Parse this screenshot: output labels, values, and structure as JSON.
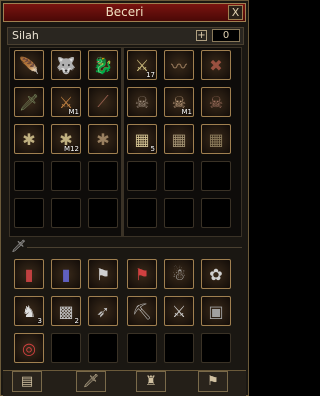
{
  "window": {
    "title": "Beceri",
    "close_label": "X"
  },
  "category": {
    "name": "Silah",
    "plus_label": "+",
    "count": "0"
  },
  "skills_grid": {
    "rows": [
      [
        {
          "icon": "wing-icon",
          "color": "#d8c090"
        },
        {
          "icon": "beast-icon",
          "color": "#c0a080"
        },
        {
          "icon": "dragon-icon",
          "color": "#b06050"
        },
        {
          "icon": "claw-icon",
          "color": "#d0c080",
          "lvl": "17"
        },
        {
          "icon": "sweep-icon",
          "color": "#a08060"
        },
        {
          "icon": "cross-slash-icon",
          "color": "#9a5040"
        }
      ],
      [
        {
          "icon": "sword-icon",
          "color": "#7a8a60"
        },
        {
          "icon": "blade-icon",
          "color": "#c08040",
          "lvl": "M1"
        },
        {
          "icon": "slash-icon",
          "color": "#9a6050"
        },
        {
          "icon": "skull-icon",
          "color": "#a09080"
        },
        {
          "icon": "skull-icon",
          "color": "#c0a080",
          "lvl": "M1"
        },
        {
          "icon": "skull-icon",
          "color": "#a07060"
        }
      ],
      [
        {
          "icon": "spider-icon",
          "color": "#c0b080"
        },
        {
          "icon": "spider-icon",
          "color": "#c0b080",
          "lvl": "M12"
        },
        {
          "icon": "spider-icon",
          "color": "#9a8060"
        },
        {
          "icon": "grid-icon",
          "color": "#d0c090",
          "lvl": "5"
        },
        {
          "icon": "grid-icon",
          "color": "#a09070"
        },
        {
          "icon": "grid-icon",
          "color": "#8a7a5a"
        }
      ]
    ]
  },
  "passive_grid": {
    "rows": [
      [
        {
          "icon": "book-icon",
          "color": "#c04040"
        },
        {
          "icon": "book-icon",
          "color": "#6060c0"
        },
        {
          "icon": "flag-icon",
          "color": "#d0d0d0"
        },
        {
          "icon": "flag-up-icon",
          "color": "#d04040"
        },
        {
          "icon": "group-icon",
          "color": "#c0c0c0"
        },
        {
          "icon": "knot-icon",
          "color": "#d0d0d0"
        }
      ],
      [
        {
          "icon": "horse-icon",
          "color": "#e0e0e0",
          "lvl": "3"
        },
        {
          "icon": "rune-icon",
          "color": "#c0c0c0",
          "lvl": "2"
        },
        {
          "icon": "bow-icon",
          "color": "#c0c0c0"
        },
        {
          "icon": "pickaxe-icon",
          "color": "#c0c0c0"
        },
        {
          "icon": "claw-icon",
          "color": "#d0d0d0"
        },
        {
          "icon": "lock-icon",
          "color": "#a0a0a0"
        }
      ],
      [
        {
          "icon": "target-icon",
          "color": "#d04040"
        }
      ]
    ]
  },
  "tabs": [
    {
      "icon": "scroll-icon"
    },
    {
      "icon": "sword-tab-icon"
    },
    {
      "icon": "warrior-icon"
    },
    {
      "icon": "flag-tab-icon"
    }
  ]
}
